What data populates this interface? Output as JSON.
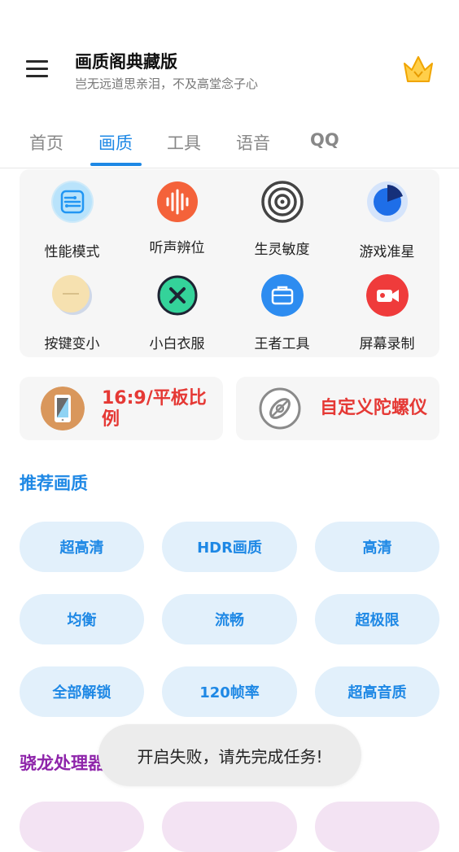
{
  "header": {
    "title": "画质阁典藏版",
    "subtitle": "岂无远道思亲泪，不及高堂念子心"
  },
  "tabs": [
    {
      "label": "首页",
      "active": false
    },
    {
      "label": "画质",
      "active": true
    },
    {
      "label": "工具",
      "active": false
    },
    {
      "label": "语音",
      "active": false
    },
    {
      "label": "QQ",
      "active": false
    }
  ],
  "grid": [
    {
      "label": "性能模式",
      "icon": "circuit-icon"
    },
    {
      "label": "听声辨位",
      "icon": "sound-wave-icon"
    },
    {
      "label": "生灵敏度",
      "icon": "target-icon"
    },
    {
      "label": "游戏准星",
      "icon": "pie-chart-icon"
    },
    {
      "label": "按键变小",
      "icon": "minus-circle-icon"
    },
    {
      "label": "小白衣服",
      "icon": "close-circle-icon"
    },
    {
      "label": "王者工具",
      "icon": "toolbox-icon"
    },
    {
      "label": "屏幕录制",
      "icon": "video-record-icon"
    }
  ],
  "cards": [
    {
      "label": "16:9/平板比例",
      "icon": "phone-ratio-icon"
    },
    {
      "label": "自定义陀螺仪",
      "icon": "gyroscope-icon"
    }
  ],
  "recommended": {
    "title": "推荐画质",
    "items": [
      "超高清",
      "HDR画质",
      "高清",
      "均衡",
      "流畅",
      "超极限",
      "全部解锁",
      "120帧率",
      "超高音质"
    ]
  },
  "snapdragon": {
    "title": "骁龙处理器"
  },
  "toast": "开启失败，请先完成任务!",
  "colors": {
    "accent": "#1e88e5",
    "warning": "#e53935",
    "purple": "#8e24aa"
  }
}
